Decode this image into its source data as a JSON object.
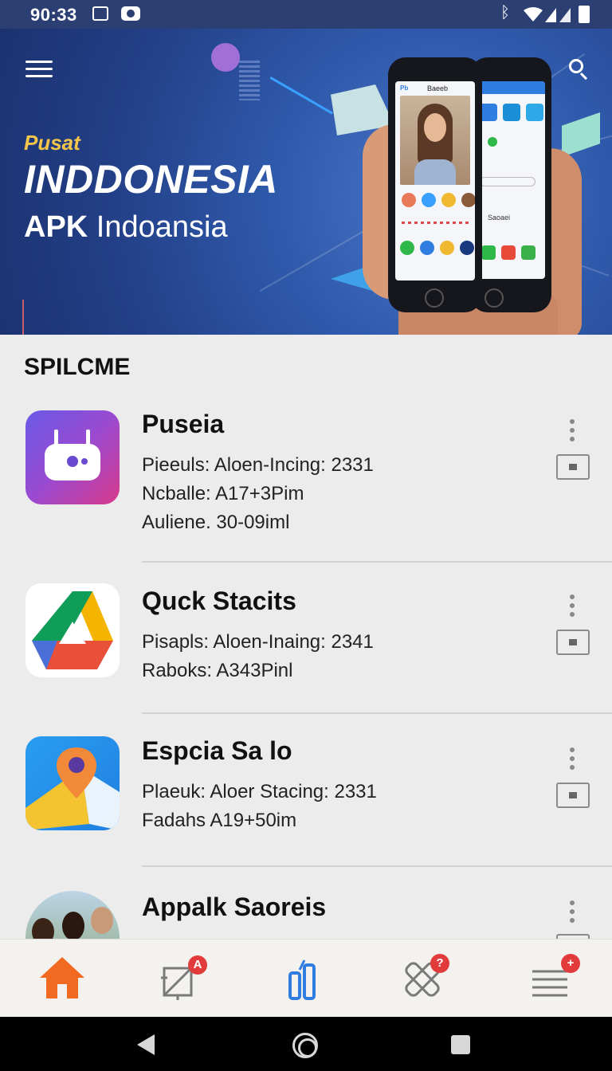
{
  "status_bar": {
    "time": "90:33",
    "icons": [
      "sim-card-icon",
      "camera-icon",
      "bluetooth-icon",
      "wifi-icon",
      "signal-icon",
      "battery-icon"
    ]
  },
  "hero": {
    "brand_top": "Pusat",
    "brand_main": "INDDONESIA",
    "brand_sub_bold": "APK",
    "brand_sub_rest": "Indoansia",
    "front_phone_header": "Baeeb",
    "back_phone_label": "Saoaei",
    "colors": {
      "background": "#2f5aac",
      "accent": "#f3c64a"
    }
  },
  "section": {
    "title": "SPILCME"
  },
  "apps": [
    {
      "name": "Puseia",
      "lines": [
        "Pieeuls: Aloen-Incing: 2331",
        "Ncballe: A17+3Pim",
        "Auliene. 30-09iml"
      ],
      "icon": "robot-app-icon"
    },
    {
      "name": "Quck Stacits",
      "lines": [
        "Pisapls: Aloen-Inaing: 2341",
        "Raboks: A343Pinl"
      ],
      "icon": "drive-app-icon"
    },
    {
      "name": "Espcia Sa lo",
      "lines": [
        "Plaeuk: Aloer Stacing: 2331",
        "Fadahs A19+50im"
      ],
      "icon": "maps-app-icon"
    },
    {
      "name": "Appalk Saoreis",
      "lines": [],
      "icon": "people-photo-icon"
    }
  ],
  "bottom_nav": {
    "items": [
      {
        "name": "home",
        "badge": ""
      },
      {
        "name": "updates",
        "badge": "A"
      },
      {
        "name": "top-charts",
        "badge": ""
      },
      {
        "name": "tools",
        "badge": "?"
      },
      {
        "name": "menu",
        "badge": "+"
      }
    ],
    "colors": {
      "home": "#f26a21",
      "charts": "#2f7de0",
      "inactive": "#7a7a7a",
      "badge": "#e23b3b"
    }
  }
}
